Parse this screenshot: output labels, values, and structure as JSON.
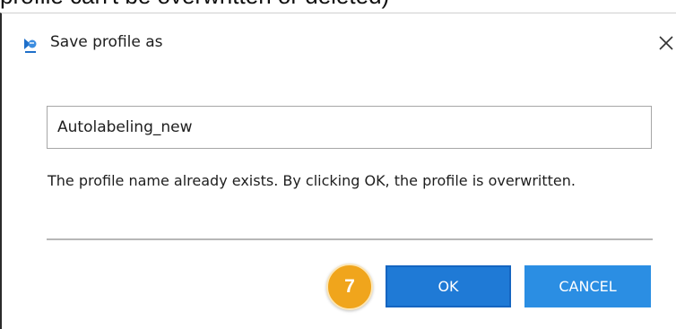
{
  "background_text": "profile can't be overwritten or deleted)",
  "dialog": {
    "title": "Save profile as",
    "title_icon": "profile-app-icon",
    "close_glyph": "✕",
    "close_icon": "close-icon"
  },
  "form": {
    "profile_name_value": "Autolabeling_new",
    "warning_message": "The profile name already exists. By clicking OK, the profile is overwritten."
  },
  "actions": {
    "ok_label": "OK",
    "cancel_label": "CANCEL"
  },
  "annotation": {
    "step_number": "7"
  },
  "colors": {
    "ok_button": "#1f7ad6",
    "cancel_button": "#2b8ee3",
    "step_badge": "#f0a51c",
    "divider": "#b7b7b7"
  }
}
